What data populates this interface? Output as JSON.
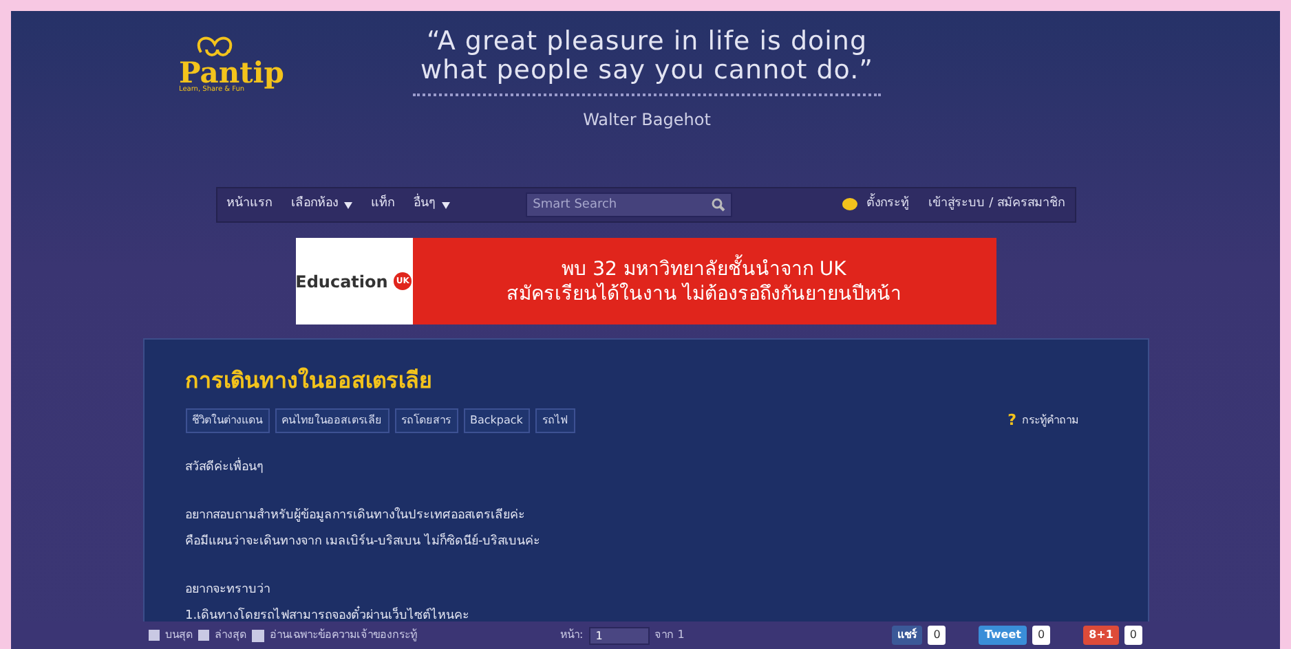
{
  "logo": {
    "name": "Pantip",
    "tagline": "Learn, Share & Fun"
  },
  "quote": {
    "text": "“A great pleasure in life is doing what people say you cannot do.”",
    "author": "Walter Bagehot"
  },
  "nav": {
    "items": [
      {
        "label": "หน้าแรก",
        "dropdown": false
      },
      {
        "label": "เลือกห้อง",
        "dropdown": true
      },
      {
        "label": "แท็ก",
        "dropdown": false
      },
      {
        "label": "อื่นๆ",
        "dropdown": true
      }
    ],
    "search": {
      "placeholder": "Smart Search"
    },
    "new_topic": "ตั้งกระทู้",
    "login": "เข้าสู่ระบบ / สมัครสมาชิก"
  },
  "ad": {
    "brand": "Education",
    "brand_mark": "UK",
    "lines": [
      "พบ 32 มหาวิทยาลัยชั้นนำจาก UK",
      "สมัครเรียนได้ในงาน ไม่ต้องรอถึงกันยายนปีหน้า"
    ]
  },
  "topic": {
    "title": "การเดินทางในออสเตรเลีย",
    "tags": [
      "ชีวิตในต่างแดน",
      "คนไทยในออสเตรเลีย",
      "รถโดยสาร",
      "Backpack",
      "รถไฟ"
    ],
    "type_mark": "?",
    "type": "กระทู้คำถาม",
    "paragraphs": [
      [
        "สวัสดีค่ะเพื่อนๆ"
      ],
      [
        "อยากสอบถามสำหรับผู้ข้อมูลการเดินทางในประเทศออสเตรเลียค่ะ",
        "คือมีแผนว่าจะเดินทางจาก เมลเบิร์น-บริสเบน ไม่ก็ซิดนีย์-บริสเบนค่ะ"
      ],
      [
        "อยากจะทราบว่า",
        "1.เดินทางโดยรถไฟสามารถจองตั๋วผ่านเว็บไซต์ไหนคะ"
      ]
    ]
  },
  "bottom_bar": {
    "top": "บนสุด",
    "bottom": "ล่างสุด",
    "owner_only": "อ่านเฉพาะข้อความเจ้าของกระทู้",
    "page_label": "หน้า:",
    "page": "1",
    "of": "จาก 1",
    "share": [
      {
        "kind": "facebook",
        "label": "แชร์",
        "count": "0"
      },
      {
        "kind": "twitter",
        "label": "Tweet",
        "count": "0"
      },
      {
        "kind": "gplus",
        "label": "8+1",
        "count": "0"
      }
    ]
  }
}
